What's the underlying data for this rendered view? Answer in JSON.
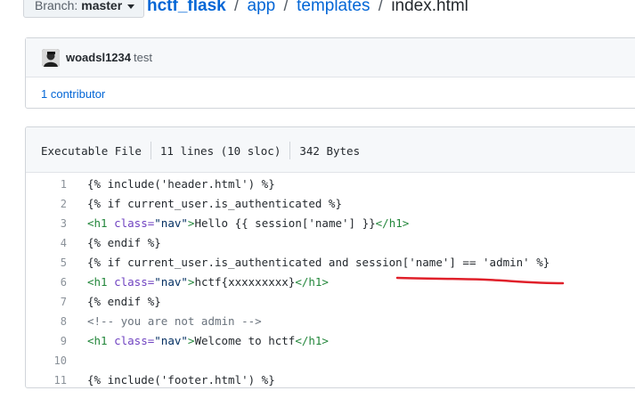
{
  "breadcrumb": {
    "branch_label": "Branch:",
    "branch_name": "master",
    "repo": "hctf_flask",
    "sep1": "/",
    "dir1": "app",
    "sep2": "/",
    "dir2": "templates",
    "sep3": "/",
    "file": "index.html"
  },
  "commit": {
    "author": "woadsl1234",
    "message": "test",
    "contributors": "1 contributor"
  },
  "file_info": {
    "mode": "Executable File",
    "lines": "11 lines (10 sloc)",
    "size": "342 Bytes"
  },
  "code": {
    "numbers": [
      "1",
      "2",
      "3",
      "4",
      "5",
      "6",
      "7",
      "8",
      "9",
      "10",
      "11"
    ],
    "l1": "{% include('header.html') %}",
    "l2": "{% if current_user.is_authenticated %}",
    "l3": {
      "open_tag": "<h1 ",
      "attr": "class=",
      "val": "\"nav\"",
      "close": ">",
      "text": "Hello {{ session['name'] }}",
      "end_tag": "</h1>"
    },
    "l4": "{% endif %}",
    "l5": "{% if current_user.is_authenticated and session['name'] == 'admin' %}",
    "l6": {
      "open_tag": "<h1 ",
      "attr": "class=",
      "val": "\"nav\"",
      "close": ">",
      "text": "hctf{xxxxxxxxx}",
      "end_tag": "</h1>"
    },
    "l7": "{% endif %}",
    "l8": "<!-- you are not admin -->",
    "l9": {
      "open_tag": "<h1 ",
      "attr": "class=",
      "val": "\"nav\"",
      "close": ">",
      "text": "Welcome to hctf",
      "end_tag": "</h1>"
    },
    "l10": "",
    "l11": "{% include('footer.html') %}"
  },
  "colors": {
    "link": "#0366d6",
    "annotation": "#e0202a"
  }
}
